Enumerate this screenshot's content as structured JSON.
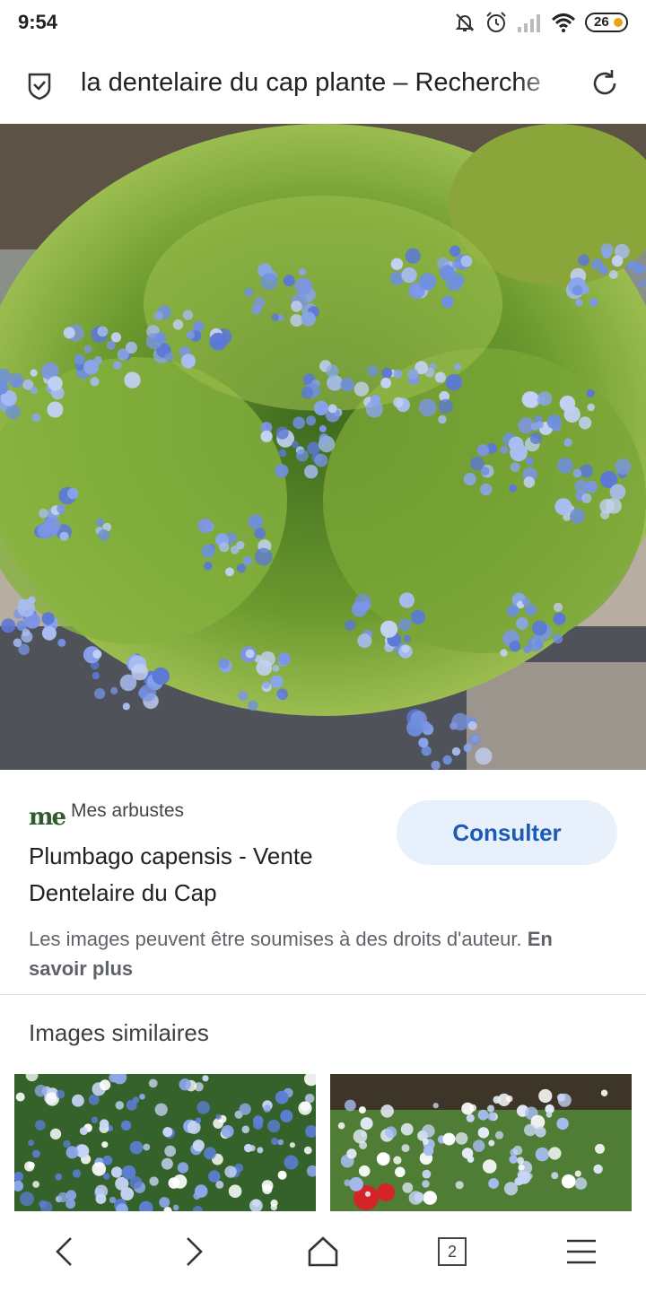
{
  "status_bar": {
    "time": "9:54",
    "battery": "26",
    "icons": [
      "bell-off-icon",
      "alarm-icon",
      "signal-icon",
      "wifi-icon",
      "battery-icon"
    ]
  },
  "address_bar": {
    "url_text": "la dentelaire du cap plante – Recherche",
    "icons": [
      "shield-check-icon",
      "reload-icon"
    ]
  },
  "result": {
    "source_logo": "me",
    "source_name": "Mes arbustes",
    "title": "Plumbago capensis - Vente Dentelaire du Cap",
    "consult_label": "Consulter",
    "rights_text": "Les images peuvent être soumises à des droits d'auteur.",
    "learn_more": "En savoir plus"
  },
  "similar": {
    "heading": "Images similaires"
  },
  "bottom_nav": {
    "tab_count": "2",
    "icons": [
      "back-icon",
      "forward-icon",
      "home-icon",
      "tabs-icon",
      "menu-icon"
    ]
  },
  "colors": {
    "accent": "#1a5bb8",
    "button_bg": "#e8f0fb",
    "flower_blue": "#6f8fe0",
    "foliage": "#7fae3a"
  }
}
